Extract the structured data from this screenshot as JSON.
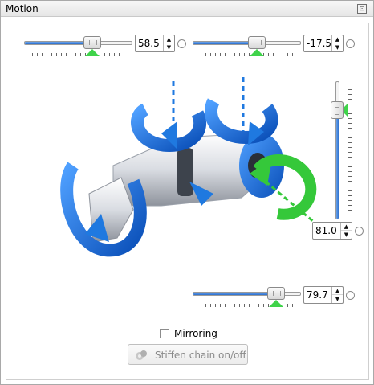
{
  "panel": {
    "title": "Motion"
  },
  "controls": {
    "slider_top_left": {
      "value": "58.5",
      "level": 0.55
    },
    "slider_top_right": {
      "value": "-17.5",
      "level": 0.56
    },
    "slider_right_vertical": {
      "value": "81.0",
      "level": 0.84
    },
    "slider_bottom": {
      "value": "79.7",
      "level": 0.77
    }
  },
  "mirroring": {
    "label": "Mirroring",
    "checked": false
  },
  "stiffen_button": {
    "label": "Stiffen chain on/off",
    "enabled": false
  },
  "colors": {
    "rotation_blue": "#1f79e0",
    "active_green": "#35c83a",
    "slider_blue": "#2c6fcf"
  }
}
